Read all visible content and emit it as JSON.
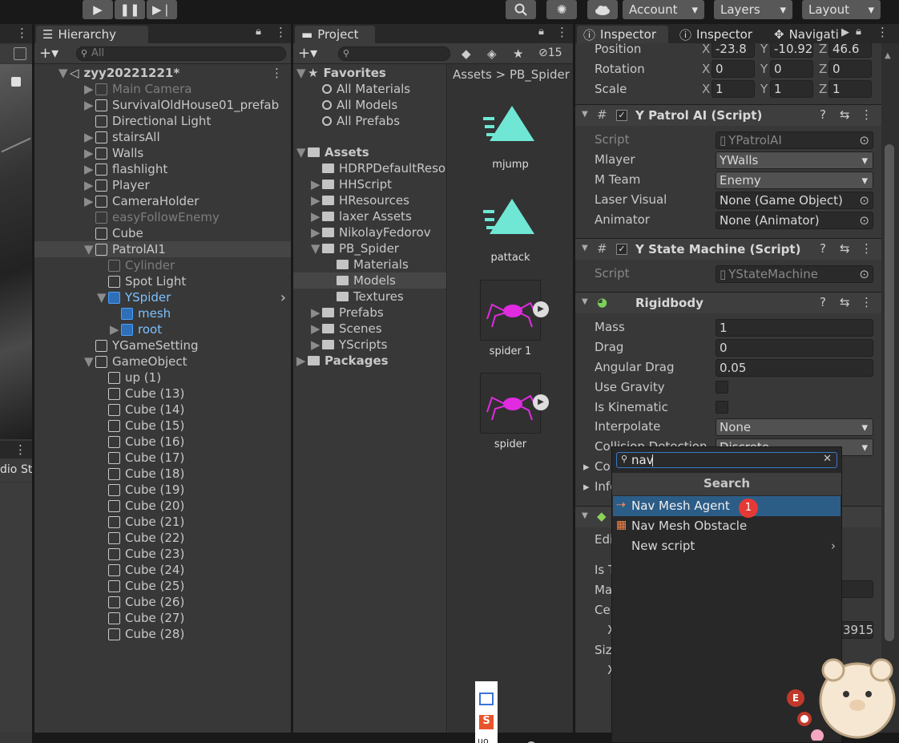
{
  "toolbar": {
    "account": "Account",
    "layers": "Layers",
    "layout": "Layout"
  },
  "hierarchy": {
    "tab": "Hierarchy",
    "search_placeholder": "All",
    "scene": "zyy20221221*",
    "items": [
      "Main Camera",
      "SurvivalOldHouse01_prefab",
      "Directional Light",
      "stairsAll",
      "Walls",
      "flashlight",
      "Player",
      "CameraHolder",
      "easyFollowEnemy",
      "Cube",
      "PatrolAI1",
      "Cylinder",
      "Spot Light",
      "YSpider",
      "mesh",
      "root",
      "YGameSetting",
      "GameObject",
      "up (1)",
      "Cube (13)",
      "Cube (14)",
      "Cube (15)",
      "Cube (16)",
      "Cube (17)",
      "Cube (18)",
      "Cube (19)",
      "Cube (20)",
      "Cube (21)",
      "Cube (22)",
      "Cube (23)",
      "Cube (24)",
      "Cube (25)",
      "Cube (26)",
      "Cube (27)",
      "Cube (28)"
    ]
  },
  "project": {
    "tab": "Project",
    "hidden_count": "15",
    "favorites": "Favorites",
    "fav_items": [
      "All Materials",
      "All Models",
      "All Prefabs"
    ],
    "assets": "Assets",
    "folders": [
      "HDRPDefaultReso",
      "HHScript",
      "HResources",
      "laxer Assets",
      "NikolayFedorov",
      "PB_Spider",
      "Materials",
      "Models",
      "Textures",
      "Prefabs",
      "Scenes",
      "YScripts"
    ],
    "packages": "Packages",
    "breadcrumb": [
      "Assets",
      "PB_Spider"
    ],
    "thumbs": [
      "mjump",
      "pattack",
      "spider 1",
      "spider"
    ]
  },
  "inspector": {
    "tabs": [
      "Inspector",
      "Inspector",
      "Navigati"
    ],
    "transform": {
      "position": "Position",
      "rotation": "Rotation",
      "scale": "Scale",
      "pos": [
        "-23.8",
        "-10.92",
        "46.6"
      ],
      "rot": [
        "0",
        "0",
        "0"
      ],
      "scl": [
        "1",
        "1",
        "1"
      ],
      "axes": [
        "X",
        "Y",
        "Z"
      ]
    },
    "patrol": {
      "title": "Y Patrol AI (Script)",
      "rows": [
        [
          "Script",
          "YPatrolAI"
        ],
        [
          "Mlayer",
          "YWalls"
        ],
        [
          "M Team",
          "Enemy"
        ],
        [
          "Laser Visual",
          "None (Game Object)"
        ],
        [
          "Animator",
          "None (Animator)"
        ]
      ]
    },
    "statemachine": {
      "title": "Y State Machine (Script)",
      "script_label": "Script",
      "script": "YStateMachine"
    },
    "rigidbody": {
      "title": "Rigidbody",
      "rows": [
        [
          "Mass",
          "1"
        ],
        [
          "Drag",
          "0"
        ],
        [
          "Angular Drag",
          "0.05"
        ],
        [
          "Use Gravity",
          ""
        ],
        [
          "Is Kinematic",
          ""
        ],
        [
          "Interpolate",
          "None"
        ]
      ],
      "collision": "Collision Detection",
      "collision_val": "Discrete",
      "co": "Co",
      "info": "Info"
    },
    "partial": [
      "Edi",
      "Is T",
      "Ma",
      "Ce",
      "X",
      "Siz",
      "X"
    ],
    "partial_field1": "l)",
    "partial_field2": "3915"
  },
  "popup": {
    "query": "nav",
    "header": "Search",
    "items": [
      "Nav Mesh Agent",
      "Nav Mesh Obstacle",
      "New script"
    ],
    "badge": "1"
  },
  "strip": {
    "label1": "dio",
    "label2": "St"
  }
}
